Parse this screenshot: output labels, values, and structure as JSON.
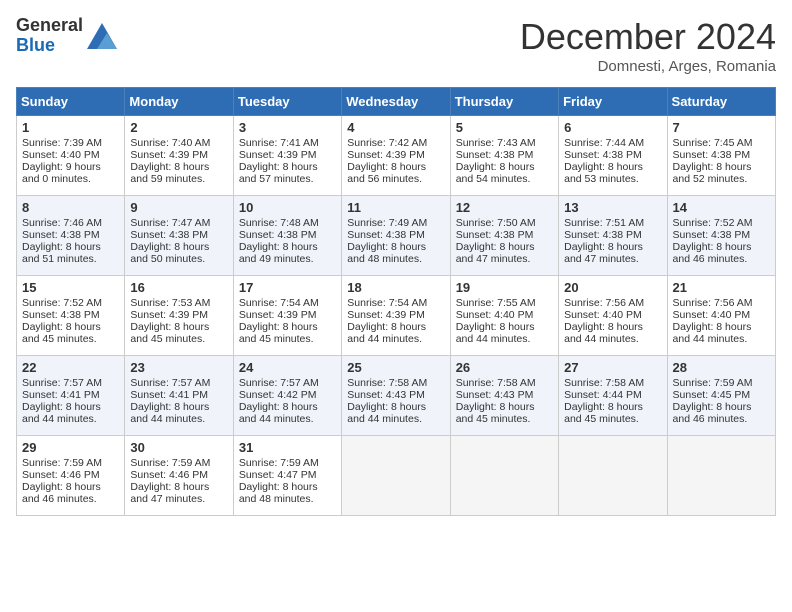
{
  "header": {
    "logo_general": "General",
    "logo_blue": "Blue",
    "month": "December 2024",
    "location": "Domnesti, Arges, Romania"
  },
  "days_of_week": [
    "Sunday",
    "Monday",
    "Tuesday",
    "Wednesday",
    "Thursday",
    "Friday",
    "Saturday"
  ],
  "weeks": [
    [
      {
        "day": "1",
        "sunrise": "7:39 AM",
        "sunset": "4:40 PM",
        "daylight": "9 hours and 0 minutes."
      },
      {
        "day": "2",
        "sunrise": "7:40 AM",
        "sunset": "4:39 PM",
        "daylight": "8 hours and 59 minutes."
      },
      {
        "day": "3",
        "sunrise": "7:41 AM",
        "sunset": "4:39 PM",
        "daylight": "8 hours and 57 minutes."
      },
      {
        "day": "4",
        "sunrise": "7:42 AM",
        "sunset": "4:39 PM",
        "daylight": "8 hours and 56 minutes."
      },
      {
        "day": "5",
        "sunrise": "7:43 AM",
        "sunset": "4:38 PM",
        "daylight": "8 hours and 54 minutes."
      },
      {
        "day": "6",
        "sunrise": "7:44 AM",
        "sunset": "4:38 PM",
        "daylight": "8 hours and 53 minutes."
      },
      {
        "day": "7",
        "sunrise": "7:45 AM",
        "sunset": "4:38 PM",
        "daylight": "8 hours and 52 minutes."
      }
    ],
    [
      {
        "day": "8",
        "sunrise": "7:46 AM",
        "sunset": "4:38 PM",
        "daylight": "8 hours and 51 minutes."
      },
      {
        "day": "9",
        "sunrise": "7:47 AM",
        "sunset": "4:38 PM",
        "daylight": "8 hours and 50 minutes."
      },
      {
        "day": "10",
        "sunrise": "7:48 AM",
        "sunset": "4:38 PM",
        "daylight": "8 hours and 49 minutes."
      },
      {
        "day": "11",
        "sunrise": "7:49 AM",
        "sunset": "4:38 PM",
        "daylight": "8 hours and 48 minutes."
      },
      {
        "day": "12",
        "sunrise": "7:50 AM",
        "sunset": "4:38 PM",
        "daylight": "8 hours and 47 minutes."
      },
      {
        "day": "13",
        "sunrise": "7:51 AM",
        "sunset": "4:38 PM",
        "daylight": "8 hours and 47 minutes."
      },
      {
        "day": "14",
        "sunrise": "7:52 AM",
        "sunset": "4:38 PM",
        "daylight": "8 hours and 46 minutes."
      }
    ],
    [
      {
        "day": "15",
        "sunrise": "7:52 AM",
        "sunset": "4:38 PM",
        "daylight": "8 hours and 45 minutes."
      },
      {
        "day": "16",
        "sunrise": "7:53 AM",
        "sunset": "4:39 PM",
        "daylight": "8 hours and 45 minutes."
      },
      {
        "day": "17",
        "sunrise": "7:54 AM",
        "sunset": "4:39 PM",
        "daylight": "8 hours and 45 minutes."
      },
      {
        "day": "18",
        "sunrise": "7:54 AM",
        "sunset": "4:39 PM",
        "daylight": "8 hours and 44 minutes."
      },
      {
        "day": "19",
        "sunrise": "7:55 AM",
        "sunset": "4:40 PM",
        "daylight": "8 hours and 44 minutes."
      },
      {
        "day": "20",
        "sunrise": "7:56 AM",
        "sunset": "4:40 PM",
        "daylight": "8 hours and 44 minutes."
      },
      {
        "day": "21",
        "sunrise": "7:56 AM",
        "sunset": "4:40 PM",
        "daylight": "8 hours and 44 minutes."
      }
    ],
    [
      {
        "day": "22",
        "sunrise": "7:57 AM",
        "sunset": "4:41 PM",
        "daylight": "8 hours and 44 minutes."
      },
      {
        "day": "23",
        "sunrise": "7:57 AM",
        "sunset": "4:41 PM",
        "daylight": "8 hours and 44 minutes."
      },
      {
        "day": "24",
        "sunrise": "7:57 AM",
        "sunset": "4:42 PM",
        "daylight": "8 hours and 44 minutes."
      },
      {
        "day": "25",
        "sunrise": "7:58 AM",
        "sunset": "4:43 PM",
        "daylight": "8 hours and 44 minutes."
      },
      {
        "day": "26",
        "sunrise": "7:58 AM",
        "sunset": "4:43 PM",
        "daylight": "8 hours and 45 minutes."
      },
      {
        "day": "27",
        "sunrise": "7:58 AM",
        "sunset": "4:44 PM",
        "daylight": "8 hours and 45 minutes."
      },
      {
        "day": "28",
        "sunrise": "7:59 AM",
        "sunset": "4:45 PM",
        "daylight": "8 hours and 46 minutes."
      }
    ],
    [
      {
        "day": "29",
        "sunrise": "7:59 AM",
        "sunset": "4:46 PM",
        "daylight": "8 hours and 46 minutes."
      },
      {
        "day": "30",
        "sunrise": "7:59 AM",
        "sunset": "4:46 PM",
        "daylight": "8 hours and 47 minutes."
      },
      {
        "day": "31",
        "sunrise": "7:59 AM",
        "sunset": "4:47 PM",
        "daylight": "8 hours and 48 minutes."
      },
      null,
      null,
      null,
      null
    ]
  ]
}
